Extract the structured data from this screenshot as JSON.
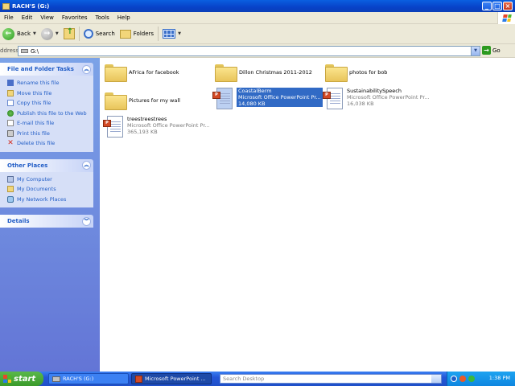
{
  "window": {
    "title": "RACH'S (G:)",
    "controls": {
      "minimize": "_",
      "maximize": "□",
      "close": "×"
    }
  },
  "menu": [
    "File",
    "Edit",
    "View",
    "Favorites",
    "Tools",
    "Help"
  ],
  "toolbar": {
    "back_label": "Back",
    "search_label": "Search",
    "folders_label": "Folders"
  },
  "address": {
    "label": "ddress",
    "path": "G:\\",
    "go_label": "Go"
  },
  "left_pane": {
    "file_tasks": {
      "title": "File and Folder Tasks",
      "items": [
        {
          "label": "Rename this file",
          "icon": "rename-icon"
        },
        {
          "label": "Move this file",
          "icon": "move-icon"
        },
        {
          "label": "Copy this file",
          "icon": "copy-icon"
        },
        {
          "label": "Publish this file to the Web",
          "icon": "publish-icon"
        },
        {
          "label": "E-mail this file",
          "icon": "email-icon"
        },
        {
          "label": "Print this file",
          "icon": "print-icon"
        },
        {
          "label": "Delete this file",
          "icon": "delete-icon"
        }
      ]
    },
    "other_places": {
      "title": "Other Places",
      "items": [
        {
          "label": "My Computer",
          "icon": "my-computer-icon"
        },
        {
          "label": "My Documents",
          "icon": "my-documents-icon"
        },
        {
          "label": "My Network Places",
          "icon": "my-network-icon"
        }
      ]
    },
    "details": {
      "title": "Details"
    }
  },
  "files": {
    "folders": [
      {
        "name": "AFrica for facebook"
      },
      {
        "name": "Dillon Christmas 2011-2012"
      },
      {
        "name": "photos for bob"
      },
      {
        "name": "Pictures for my wall"
      }
    ],
    "presentations": [
      {
        "name": "CoastalBerm",
        "type": "Microsoft Office PowerPoint Pr...",
        "size": "14,080 KB",
        "selected": true
      },
      {
        "name": "SustainabilitySpeech",
        "type": "Microsoft Office PowerPoint Pr...",
        "size": "16,038 KB",
        "selected": false
      },
      {
        "name": "treestreestrees",
        "type": "Microsoft Office PowerPoint Pr...",
        "size": "365,193 KB",
        "selected": false
      }
    ],
    "ppt_badge": "P"
  },
  "taskbar": {
    "start_label": "start",
    "buttons": [
      {
        "label": "RACH'S (G:)"
      },
      {
        "label": "Microsoft PowerPoint ..."
      }
    ],
    "search_placeholder": "Search Desktop",
    "clock": "1:38 PM"
  }
}
